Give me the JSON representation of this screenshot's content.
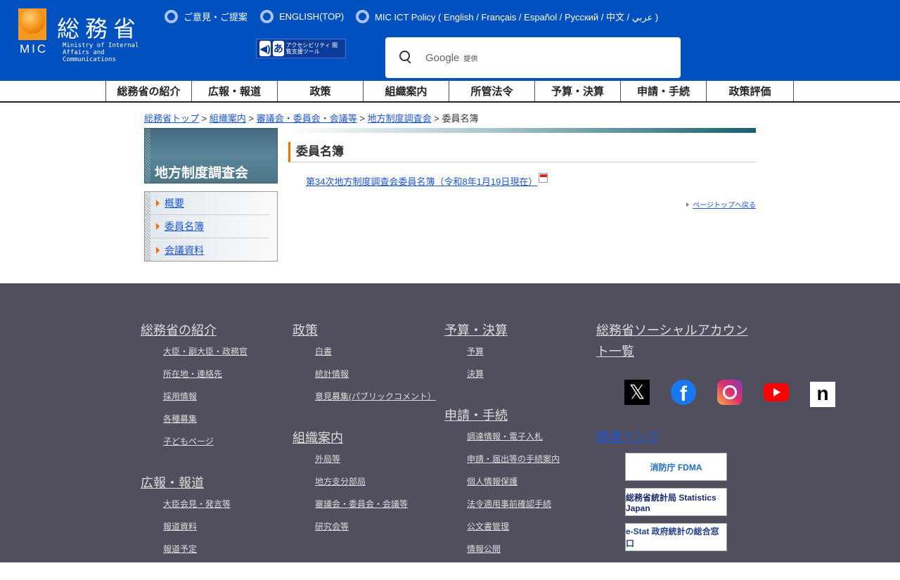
{
  "header": {
    "logo_kanji": "総務省",
    "logo_mic": "MIC",
    "logo_en": "Ministry of Internal Affairs and Communications",
    "links": [
      "ご意見・ご提案",
      "ENGLISH(TOP)",
      "MIC ICT Policy ( English / Français / Español / Русский / 中文 / عربي )"
    ],
    "accessibility": "アクセシビリティ 閲覧支援ツール",
    "search_brand": "Google",
    "search_provided": "提供"
  },
  "nav": [
    "総務省の紹介",
    "広報・報道",
    "政策",
    "組織案内",
    "所管法令",
    "予算・決算",
    "申請・手続",
    "政策評価"
  ],
  "breadcrumb": {
    "items": [
      "総務省トップ",
      "組織案内",
      "審議会・委員会・会議等",
      "地方制度調査会"
    ],
    "current": "委員名簿",
    "sep": ">"
  },
  "sidebar": {
    "title": "地方制度調査会",
    "items": [
      "概要",
      "委員名簿",
      "会議資料"
    ]
  },
  "main": {
    "heading": "委員名簿",
    "doc_link": "第34次地方制度調査会委員名簿（令和8年1月19日現在）",
    "to_top": "ページトップへ戻る"
  },
  "footer": {
    "col1": [
      {
        "h": "総務省の紹介",
        "l": [
          "大臣・副大臣・政務官",
          "所在地・連絡先",
          "採用情報",
          "各種募集",
          "子どもページ"
        ]
      },
      {
        "h": "広報・報道",
        "l": [
          "大臣会見・発言等",
          "報道資料",
          "報道予定"
        ]
      }
    ],
    "col2": [
      {
        "h": "政策",
        "l": [
          "白書",
          "統計情報",
          "意見募集(パブリックコメント）"
        ]
      },
      {
        "h": "組織案内",
        "l": [
          "外局等",
          "地方支分部局",
          "審議会・委員会・会議等",
          "研究会等"
        ]
      }
    ],
    "col3": [
      {
        "h": "予算・決算",
        "l": [
          "予算",
          "決算"
        ]
      },
      {
        "h": "申請・手続",
        "l": [
          "調達情報・電子入札",
          "申請・届出等の手続案内",
          "個人情報保護",
          "法令適用事前確認手続",
          "公文書管理",
          "情報公開"
        ]
      }
    ],
    "social_heading": "総務省ソーシャルアカウント一覧",
    "related_heading": "関連リンク",
    "banners": [
      "消防庁 FDMA",
      "総務省統計局 Statistics Japan",
      "e-Stat 政府統計の総合窓口"
    ]
  },
  "colors": {
    "header": "#0050c0",
    "footer": "#514f5e",
    "accent": "#f27000"
  }
}
